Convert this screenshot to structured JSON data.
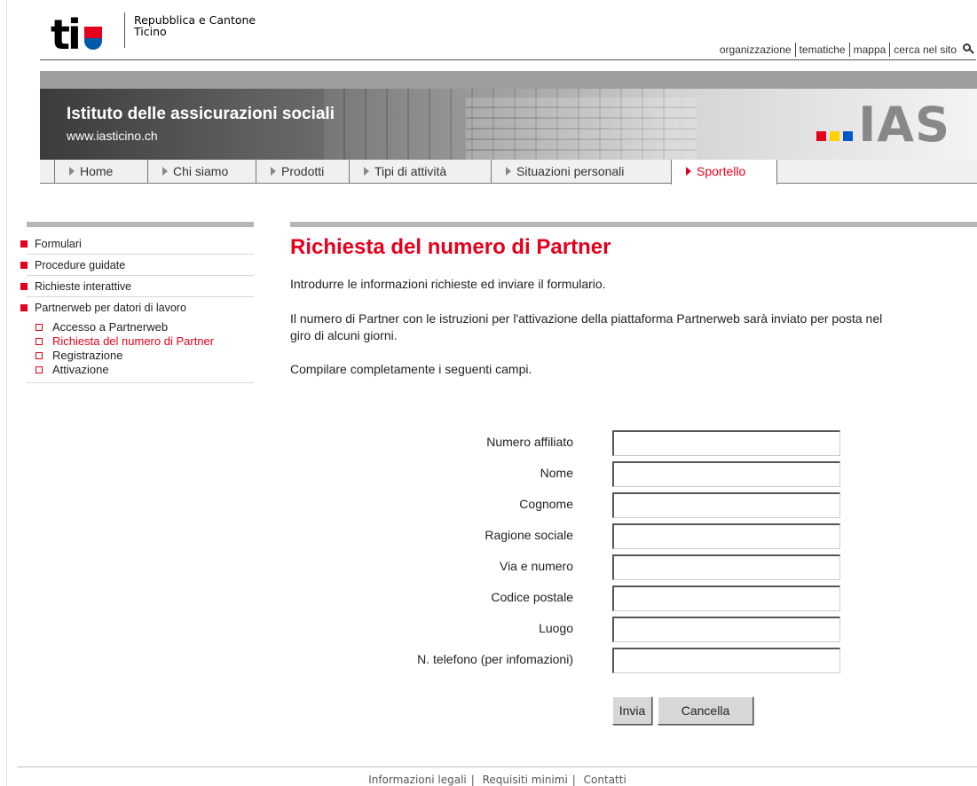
{
  "header": {
    "logo_text_line1": "Repubblica e Cantone",
    "logo_text_line2": "Ticino",
    "logo_mark": "ti",
    "top_links": [
      "organizzazione",
      "tematiche",
      "mappa",
      "cerca nel sito"
    ]
  },
  "banner": {
    "title": "Istituto delle assicurazioni sociali",
    "url": "www.iasticino.ch",
    "logo_text": "IAS",
    "logo_squares": [
      "#e4001c",
      "#ffd200",
      "#0058c8"
    ]
  },
  "nav": {
    "tabs": [
      {
        "label": "Home",
        "active": false
      },
      {
        "label": "Chi siamo",
        "active": false
      },
      {
        "label": "Prodotti",
        "active": false
      },
      {
        "label": "Tipi di attività",
        "active": false
      },
      {
        "label": "Situazioni personali",
        "active": false
      },
      {
        "label": "Sportello",
        "active": true
      }
    ]
  },
  "sidebar": {
    "items": [
      {
        "label": "Formulari"
      },
      {
        "label": "Procedure guidate"
      },
      {
        "label": "Richieste interattive"
      },
      {
        "label": "Partnerweb per datori di lavoro"
      }
    ],
    "subitems": [
      {
        "label": "Accesso a Partnerweb",
        "active": false
      },
      {
        "label": "Richiesta del numero di Partner",
        "active": true
      },
      {
        "label": "Registrazione",
        "active": false
      },
      {
        "label": "Attivazione",
        "active": false
      }
    ]
  },
  "main": {
    "title": "Richiesta del numero di Partner",
    "intro": "Introdurre le informazioni richieste ed inviare il formulario.",
    "info": "Il numero di Partner con le istruzioni per l'attivazione della piattaforma Partnerweb sarà inviato per posta nel giro di alcuni giorni.",
    "instruction": "Compilare completamente i seguenti campi."
  },
  "form": {
    "fields": [
      {
        "label": "Numero affiliato",
        "value": ""
      },
      {
        "label": "Nome",
        "value": ""
      },
      {
        "label": "Cognome",
        "value": ""
      },
      {
        "label": "Ragione sociale",
        "value": ""
      },
      {
        "label": "Via e numero",
        "value": ""
      },
      {
        "label": "Codice postale",
        "value": ""
      },
      {
        "label": "Luogo",
        "value": ""
      },
      {
        "label": "N. telefono (per infomazioni)",
        "value": ""
      }
    ],
    "submit_label": "Invia",
    "reset_label": "Cancella"
  },
  "footer": {
    "links": [
      "Informazioni legali",
      "Requisiti minimi",
      "Contatti"
    ]
  },
  "colors": {
    "accent": "#e4001c",
    "nav_bg": "#f0f0f0",
    "band_gray": "#9e9e9e"
  }
}
